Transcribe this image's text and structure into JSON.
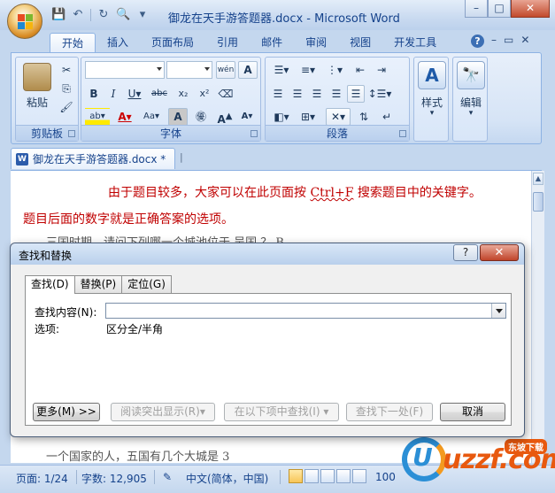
{
  "window": {
    "title": "御龙在天手游答题器.docx - Microsoft Word",
    "min_icon": "minimize-icon",
    "max_icon": "maximize-icon",
    "close_label": "✕"
  },
  "ribbon": {
    "tabs": [
      "开始",
      "插入",
      "页面布局",
      "引用",
      "邮件",
      "审阅",
      "视图",
      "开发工具"
    ],
    "active_tab": "开始",
    "groups": {
      "clipboard": {
        "label": "剪贴板",
        "paste": "粘贴"
      },
      "font": {
        "label": "字体",
        "font_name": "",
        "font_size": ""
      },
      "paragraph": {
        "label": "段落"
      },
      "styles": {
        "label": "样式"
      },
      "editing": {
        "label": "编辑"
      }
    }
  },
  "document_tab": {
    "name": "御龙在天手游答题器.docx *"
  },
  "document": {
    "line1_prefix": "由于题目较多，大家可以在此页面按 ",
    "line1_key": "Ctrl+F",
    "line1_suffix": " 搜索题目中的关键字。",
    "line2": "题目后面的数字就是正确答案的选项。",
    "line3": "三国时期，请问下列哪一个城池位于 吴国 ？ B",
    "line4": "一个国家的人，五国有几个大城是 3"
  },
  "dialog": {
    "title": "查找和替换",
    "help_label": "?",
    "close_label": "✕",
    "tabs": [
      "查找(D)",
      "替换(P)",
      "定位(G)"
    ],
    "active_tab": "查找(D)",
    "find_label": "查找内容(N):",
    "find_value": "",
    "options_label": "选项:",
    "options_value": "区分全/半角",
    "buttons": {
      "more": "更多(M) >>",
      "reading_highlight": "阅读突出显示(R)▾",
      "find_in": "在以下项中查找(I) ▾",
      "find_next": "查找下一处(F)",
      "cancel": "取消"
    }
  },
  "status": {
    "page": "页面: 1/24",
    "words": "字数: 12,905",
    "language": "中文(简体，中国)",
    "zoom": "100"
  },
  "watermark": {
    "text": "uzzf.com",
    "badge": "东坡下载",
    "letter": "U"
  },
  "colors": {
    "accent": "#15428b",
    "doc_text": "#c00000",
    "close_red": "#c0442a"
  }
}
